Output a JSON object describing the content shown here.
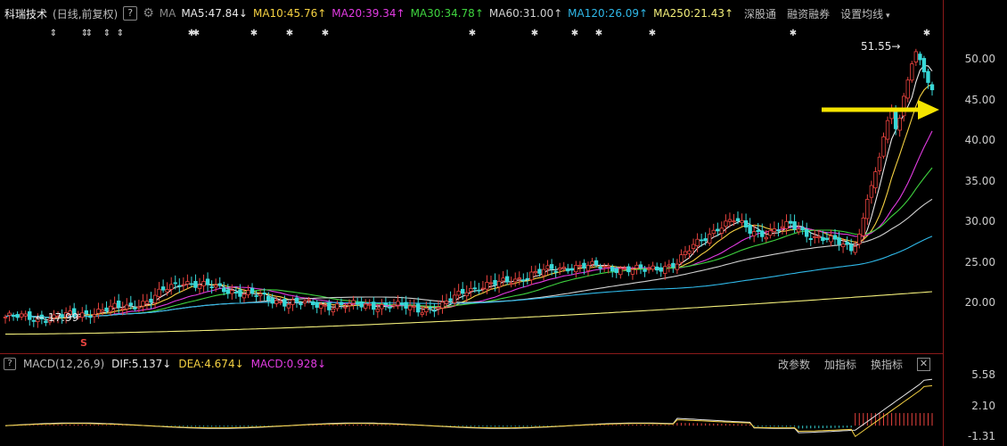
{
  "header": {
    "stock_name": "科瑞技术",
    "period": "(日线,前复权)",
    "help_label": "?",
    "ma_label": "MA",
    "ma_items": [
      {
        "text": "MA5:47.84",
        "arrow": "↓",
        "color": "#e8e8e8"
      },
      {
        "text": "MA10:45.76",
        "arrow": "↑",
        "color": "#f5d142"
      },
      {
        "text": "MA20:39.34",
        "arrow": "↑",
        "color": "#e23be2"
      },
      {
        "text": "MA30:34.78",
        "arrow": "↑",
        "color": "#3fd43f"
      },
      {
        "text": "MA60:31.00",
        "arrow": "↑",
        "color": "#d0d0d0"
      },
      {
        "text": "MA120:26.09",
        "arrow": "↑",
        "color": "#2fb8e8"
      },
      {
        "text": "MA250:21.43",
        "arrow": "↑",
        "color": "#f2ee7a"
      }
    ],
    "tools": [
      "深股通",
      "融资融券",
      "设置均线"
    ]
  },
  "colors": {
    "up": "#e8433e",
    "down": "#38d8d8",
    "ma5": "#e8e8e8",
    "ma10": "#f5d142",
    "ma20": "#e23be2",
    "ma30": "#3fd43f",
    "ma60": "#d0d0d0",
    "ma120": "#2fb8e8",
    "ma250": "#f2ee7a",
    "axis_border": "#8b1a1a",
    "arrow": "#f5e400"
  },
  "chart_data": [
    {
      "type": "candlestick",
      "title": "",
      "yticks": [
        "50.00",
        "45.00",
        "40.00",
        "35.00",
        "30.00",
        "25.00",
        "20.00"
      ],
      "ylim": [
        16,
        53
      ],
      "annotations": {
        "high_label": "51.55",
        "low_label": "17.99",
        "signal_label": "S"
      },
      "grid": false,
      "series": [
        {
          "name": "MA5:47.84",
          "last": 47.84
        },
        {
          "name": "MA10:45.76",
          "last": 45.76
        },
        {
          "name": "MA20:39.34",
          "last": 39.34
        },
        {
          "name": "MA30:34.78",
          "last": 34.78
        },
        {
          "name": "MA60:31.00",
          "last": 31.0
        },
        {
          "name": "MA120:26.09",
          "last": 26.09
        },
        {
          "name": "MA250:21.43",
          "last": 21.43
        }
      ]
    },
    {
      "type": "bar",
      "title": "MACD(12,26,9)",
      "yticks": [
        "5.58",
        "2.10",
        "-1.31"
      ],
      "ylim": [
        -1.31,
        5.58
      ],
      "series": [
        {
          "name": "DIF:5.137",
          "last": 5.137
        },
        {
          "name": "DEA:4.674",
          "last": 4.674
        },
        {
          "name": "MACD:0.928",
          "last": 0.928
        }
      ]
    }
  ],
  "macd": {
    "title": "MACD(12,26,9)",
    "dif": "DIF:5.137",
    "dif_arrow": "↓",
    "dea": "DEA:4.674",
    "dea_arrow": "↓",
    "macd": "MACD:0.928",
    "macd_arrow": "↓",
    "tools": [
      "改参数",
      "加指标",
      "换指标"
    ],
    "close_label": "✕"
  }
}
